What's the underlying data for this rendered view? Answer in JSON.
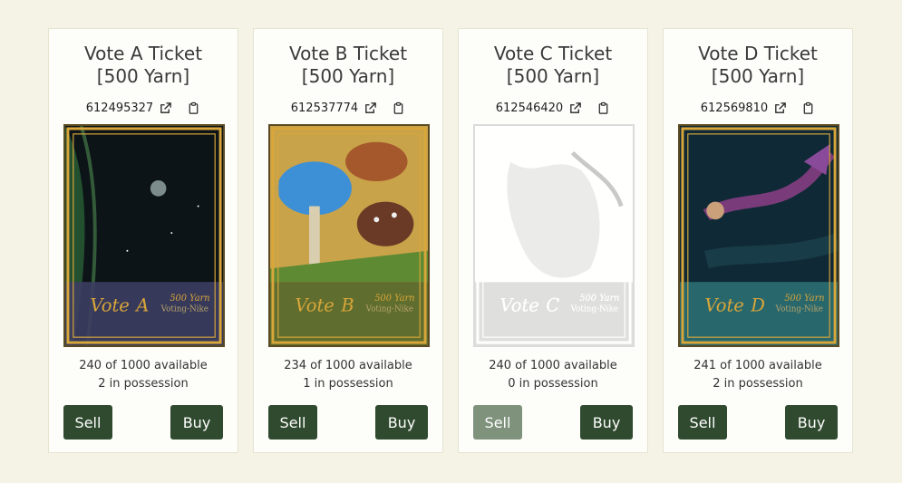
{
  "cards": [
    {
      "title": "Vote A Ticket [500 Yarn]",
      "id": "612495327",
      "vote_letter": "A",
      "available": "240 of 1000 available",
      "possession": "2 in possession",
      "sell_label": "Sell",
      "buy_label": "Buy",
      "bg": "#3c3d62"
    },
    {
      "title": "Vote B Ticket [500 Yarn]",
      "id": "612537774",
      "vote_letter": "B",
      "available": "234 of 1000 available",
      "possession": "1 in possession",
      "sell_label": "Sell",
      "buy_label": "Buy",
      "bg": "#5a6a2c"
    },
    {
      "title": "Vote C Ticket [500 Yarn]",
      "id": "612546420",
      "vote_letter": "C",
      "available": "240 of 1000 available",
      "possession": "0 in possession",
      "sell_label": "Sell",
      "buy_label": "Buy",
      "bg": "#9a9a9a"
    },
    {
      "title": "Vote D Ticket [500 Yarn]",
      "id": "612569810",
      "vote_letter": "D",
      "available": "241 of 1000 available",
      "possession": "2 in possession",
      "sell_label": "Sell",
      "buy_label": "Buy",
      "bg": "#2a6a70"
    }
  ],
  "card_art_text": {
    "vote_word": "Vote",
    "yarn": "500 Yarn",
    "subtitle": "Voting-Nike"
  },
  "colors": {
    "button": "#2f4a2e",
    "button_disabled": "#7e927c",
    "frame_gold": "#d9a63a"
  },
  "icons": {
    "external": "external-link-icon",
    "copy": "clipboard-icon"
  }
}
